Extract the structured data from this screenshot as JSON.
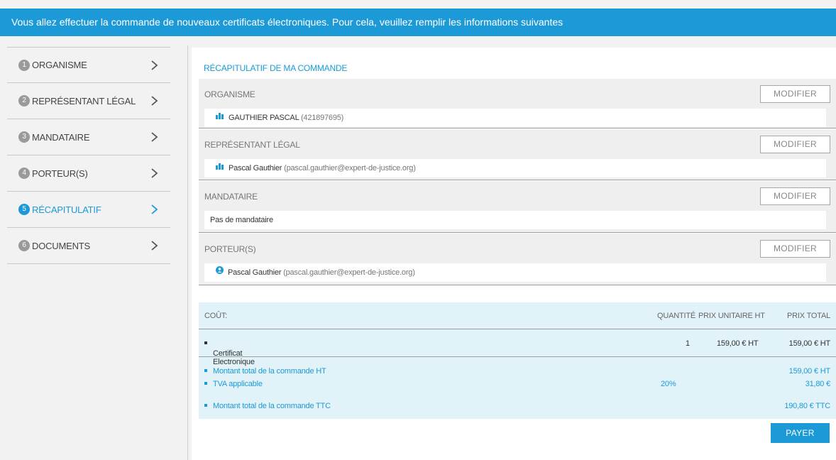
{
  "banner": {
    "text": "Vous allez effectuer la commande de nouveaux certificats électroniques. Pour cela, veuillez remplir les informations suivantes"
  },
  "sidebar": {
    "items": [
      {
        "num": "1",
        "label": "ORGANISME"
      },
      {
        "num": "2",
        "label": "REPRÉSENTANT LÉGAL"
      },
      {
        "num": "3",
        "label": "MANDATAIRE"
      },
      {
        "num": "4",
        "label": "PORTEUR(S)"
      },
      {
        "num": "5",
        "label": "RÉCAPITULATIF",
        "active": true
      },
      {
        "num": "6",
        "label": "DOCUMENTS"
      }
    ]
  },
  "recap": {
    "title": "RÉCAPITULATIF DE MA COMMANDE",
    "modify_label": "MODIFIER",
    "organisme": {
      "label": "ORGANISME",
      "name": "GAUTHIER PASCAL",
      "id": "(421897695)",
      "icon": "building-icon"
    },
    "representant": {
      "label": "REPRÉSENTANT LÉGAL",
      "name": "Pascal Gauthier",
      "email": "(pascal.gauthier@expert-de-justice.org)",
      "icon": "building-icon"
    },
    "mandataire": {
      "label": "MANDATAIRE",
      "value": "Pas de mandataire"
    },
    "porteurs": {
      "label": "PORTEUR(S)",
      "name": "Pascal Gauthier",
      "email": "(pascal.gauthier@expert-de-justice.org)",
      "icon": "user-icon"
    }
  },
  "cost": {
    "headers": {
      "cost": "COÛT:",
      "quantity": "QUANTITÉ",
      "unit_price": "PRIX UNITAIRE HT",
      "total_price": "PRIX TOTAL"
    },
    "items": [
      {
        "label": "Certificat Electronique",
        "quantity": "1",
        "unit_price": "159,00 € HT",
        "total": "159,00 € HT"
      }
    ],
    "total_ht": {
      "label": "Montant total de la commande HT",
      "value": "159,00 € HT"
    },
    "tva": {
      "label": "TVA applicable",
      "rate": "20%",
      "value": "31,80 €"
    },
    "total_ttc": {
      "label": "Montant total de la commande TTC",
      "value": "190,80 € TTC"
    }
  },
  "pay_label": "PAYER",
  "colors": {
    "accent": "#1b9ad7",
    "cost_bg": "#e2f2f9",
    "section_bg": "#efefef"
  }
}
